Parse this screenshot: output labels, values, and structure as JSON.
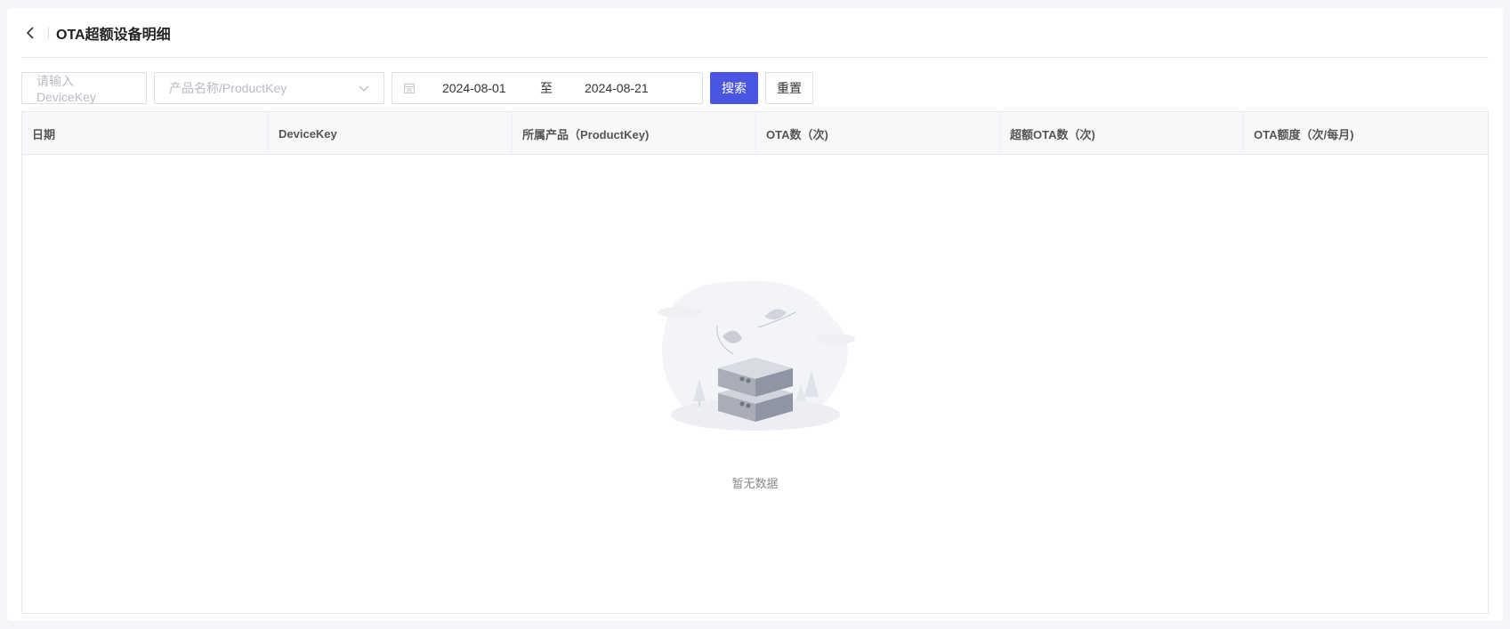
{
  "header": {
    "title": "OTA超额设备明细"
  },
  "filters": {
    "device_placeholder": "请输入DeviceKey",
    "product_placeholder": "产品名称/ProductKey",
    "date_start": "2024-08-01",
    "date_separator": "至",
    "date_end": "2024-08-21",
    "search_label": "搜索",
    "reset_label": "重置"
  },
  "table": {
    "columns": [
      "日期",
      "DeviceKey",
      "所属产品（ProductKey)",
      "OTA数（次)",
      "超额OTA数（次)",
      "OTA额度（次/每月)"
    ],
    "rows": []
  },
  "empty": {
    "text": "暂无数据"
  },
  "colors": {
    "primary": "#4a56e2",
    "border": "#dcdfe6",
    "header_bg": "#f7f8fa"
  }
}
